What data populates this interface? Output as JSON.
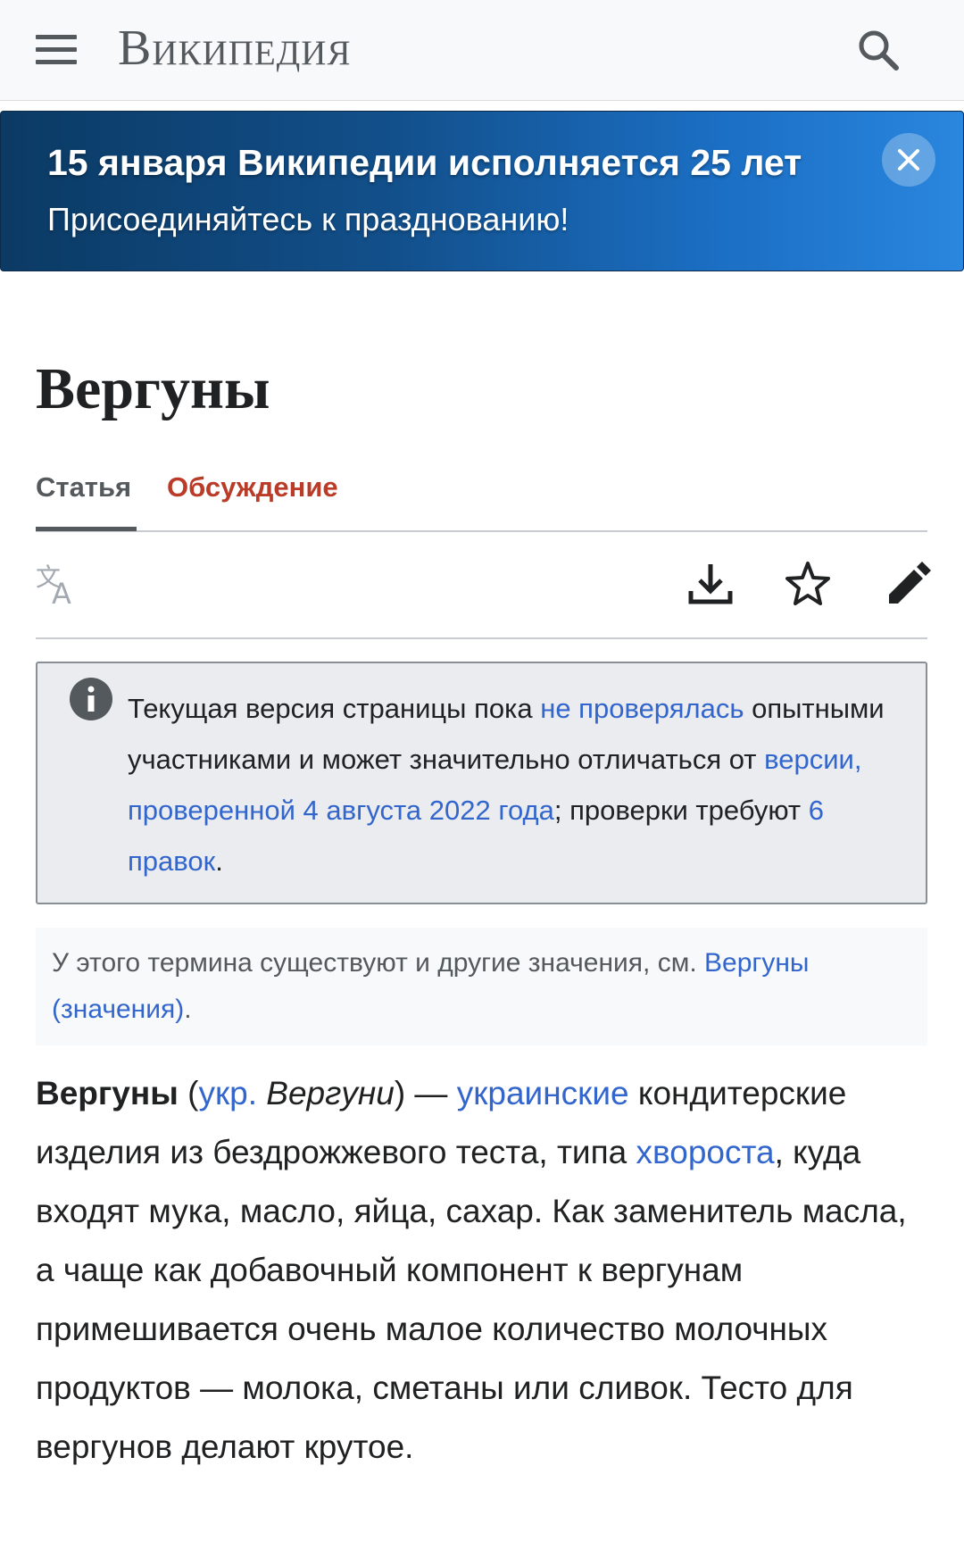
{
  "header": {
    "wordmark": "Википедия",
    "menu_icon": "hamburger-menu-icon",
    "search_icon": "search-icon"
  },
  "banner": {
    "title": "15 января Википедии исполняется 25 лет",
    "subtitle": "Присоединяйтесь к празднованию!",
    "close_icon": "close-icon"
  },
  "page": {
    "title": "Вергуны"
  },
  "tabs": [
    {
      "label": "Статья",
      "active": true
    },
    {
      "label": "Обсуждение",
      "active": false
    }
  ],
  "toolbar": {
    "icons": [
      "language-icon",
      "download-icon",
      "star-icon",
      "edit-pencil-icon"
    ]
  },
  "notice": {
    "icon": "info-icon",
    "text_1": "Текущая версия страницы пока ",
    "link_1": "не проверялась",
    "text_2": " опытными участниками и может значительно отличаться от ",
    "link_2": "версии, проверенной 4 августа 2022 года",
    "text_3": "; проверки требуют ",
    "link_3": "6 правок",
    "text_4": "."
  },
  "hatnote": {
    "text": "У этого термина существуют и другие значения, см. ",
    "link": "Вергуны (значения)",
    "end": "."
  },
  "body": {
    "term": "Вергуны",
    "open_paren": " (",
    "lang_link": "укр.",
    "lang_word": " Вергуни",
    "close_paren": ") — ",
    "link_ukrainian": "украинские",
    "text_1": " кондитерские изделия из бездрожжевого теста, типа ",
    "link_khvorost": "хвороста",
    "text_2": ", куда входят мука, масло, яйца, сахар. Как заменитель масла, а чаще как добавочный компонент к вергунам примешивается очень малое количество молочных продуктов — молока, сметаны или сливок. Тесто для вергунов делают крутое."
  },
  "colors": {
    "link": "#3366cc",
    "talk_tab": "#ba3b27",
    "banner_start": "#0b3a64",
    "banner_end": "#2a86de"
  }
}
